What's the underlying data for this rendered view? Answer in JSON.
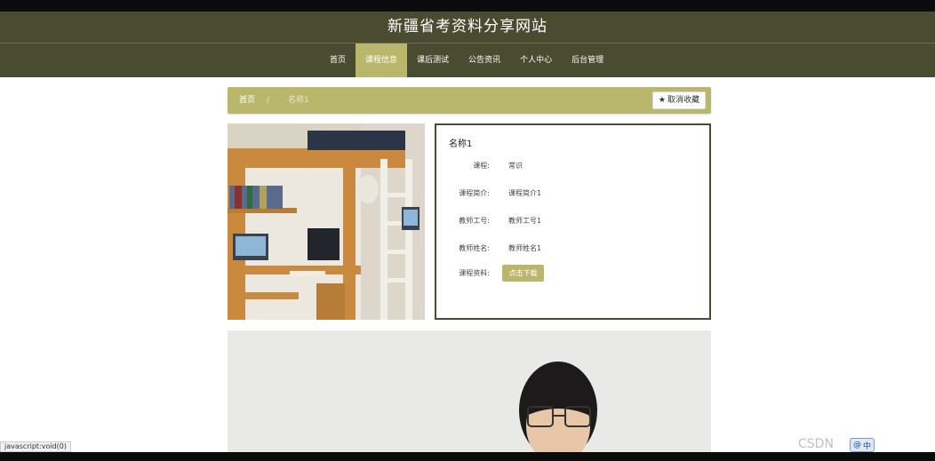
{
  "site": {
    "title": "新疆省考资料分享网站"
  },
  "nav": {
    "items": [
      {
        "label": "首页",
        "active": false
      },
      {
        "label": "课程信息",
        "active": true
      },
      {
        "label": "课后测试",
        "active": false
      },
      {
        "label": "公告资讯",
        "active": false
      },
      {
        "label": "个人中心",
        "active": false
      },
      {
        "label": "后台管理",
        "active": false
      }
    ]
  },
  "breadcrumb": {
    "home": "首页",
    "separator": "/",
    "current": "名称1"
  },
  "favorite_button": {
    "label": "取消收藏",
    "icon": "star-icon"
  },
  "detail": {
    "name": "名称1",
    "fields": [
      {
        "key": "课程:",
        "value": "常识"
      },
      {
        "key": "课程简介:",
        "value": "课程简介1"
      },
      {
        "key": "教师工号:",
        "value": "教师工号1"
      },
      {
        "key": "教师姓名:",
        "value": "教师姓名1"
      }
    ],
    "material_label": "课程资料:",
    "download_button": "点击下载"
  },
  "statusbar": {
    "text": "javascript:void(0)"
  },
  "overlay": {
    "watermark": "CSDN",
    "ime_label": "中"
  },
  "colors": {
    "header_bg": "#4a4c32",
    "accent": "#b9b76b"
  }
}
